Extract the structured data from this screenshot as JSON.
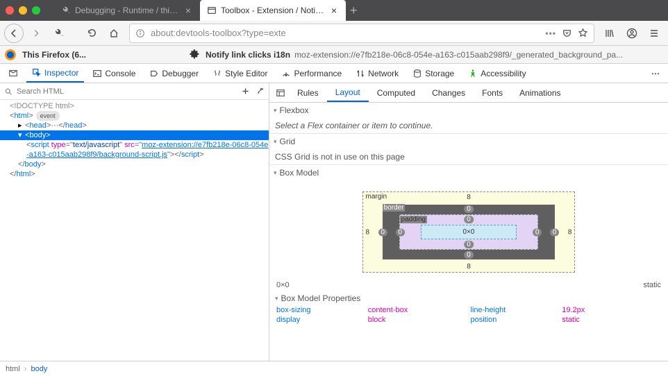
{
  "tabs": [
    {
      "title": "Debugging - Runtime / this-fire",
      "active": false
    },
    {
      "title": "Toolbox - Extension / Notify link",
      "active": true
    }
  ],
  "url": "about:devtools-toolbox?type=exte",
  "context": {
    "firefox_label": "This Firefox (6...",
    "ext_name": "Notify link clicks i18n",
    "ext_url": "moz-extension://e7fb218e-06c8-054e-a163-c015aab298f9/_generated_background_pa..."
  },
  "devtools_tabs": [
    "Inspector",
    "Console",
    "Debugger",
    "Style Editor",
    "Performance",
    "Network",
    "Storage",
    "Accessibility"
  ],
  "search_placeholder": "Search HTML",
  "dom": {
    "doctype": "<!DOCTYPE html>",
    "html_open": "html",
    "event_pill": "event",
    "head_open": "head",
    "head_close": "head",
    "body_open": "body",
    "script_tag": "script",
    "script_type_attr": "type",
    "script_type_val": "text/javascript",
    "script_src_attr": "src",
    "script_src_val": "moz-extension://e7fb218e-06c8-054e-a163-c015aab298f9/background-script.js",
    "body_close": "body",
    "html_close": "html"
  },
  "sidebar_tabs": [
    "Rules",
    "Layout",
    "Computed",
    "Changes",
    "Fonts",
    "Animations"
  ],
  "flexbox": {
    "title": "Flexbox",
    "msg": "Select a Flex container or item to continue."
  },
  "grid": {
    "title": "Grid",
    "msg": "CSS Grid is not in use on this page"
  },
  "boxmodel": {
    "title": "Box Model",
    "margin_lbl": "margin",
    "border_lbl": "border",
    "padding_lbl": "padding",
    "margin_t": "8",
    "margin_r": "8",
    "margin_b": "8",
    "margin_l": "8",
    "border_t": "0",
    "border_r": "0",
    "border_b": "0",
    "border_l": "0",
    "padding_t": "0",
    "padding_r": "0",
    "padding_b": "0",
    "padding_l": "0",
    "content": "0×0",
    "footer_size": "0×0",
    "footer_pos": "static",
    "props_title": "Box Model Properties",
    "props": [
      {
        "name": "box-sizing",
        "value": "content-box"
      },
      {
        "name": "display",
        "value": "block"
      },
      {
        "name": "line-height",
        "value": "19.2px"
      },
      {
        "name": "position",
        "value": "static"
      }
    ]
  },
  "breadcrumb": [
    "html",
    "body"
  ]
}
